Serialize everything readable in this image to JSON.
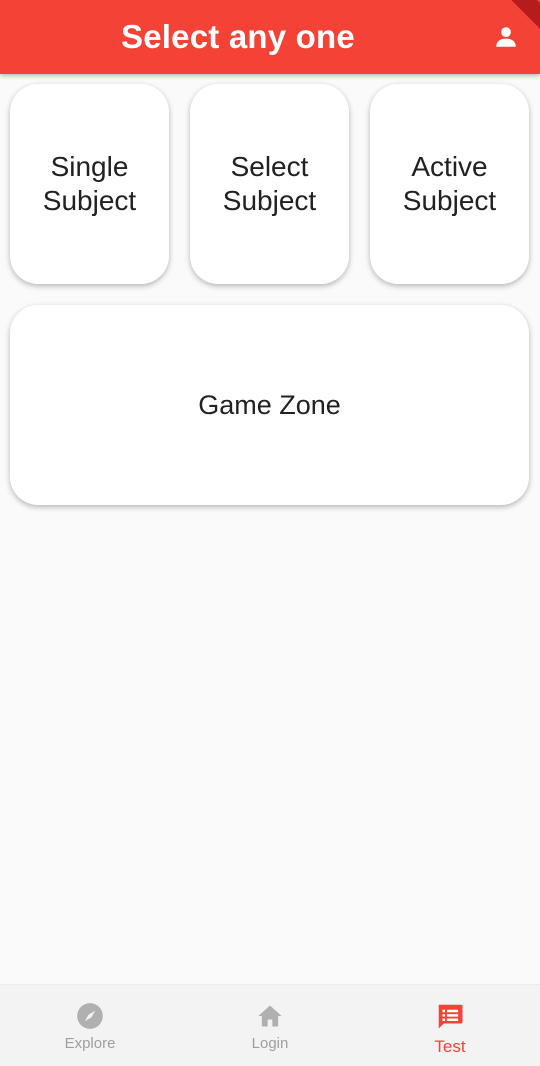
{
  "app_bar": {
    "title": "Select any one",
    "profile_icon": "person-icon",
    "color": "#f44336"
  },
  "cards": [
    {
      "line1": "Single",
      "line2": "Subject"
    },
    {
      "line1": "Select",
      "line2": "Subject"
    },
    {
      "line1": "Active",
      "line2": "Subject"
    }
  ],
  "game_zone": {
    "label": "Game Zone"
  },
  "bottom_nav": {
    "items": [
      {
        "label": "Explore",
        "icon": "compass-icon",
        "active": false
      },
      {
        "label": "Login",
        "icon": "home-icon",
        "active": false
      },
      {
        "label": "Test",
        "icon": "chat-list-icon",
        "active": true
      }
    ],
    "active_color": "#f44336",
    "inactive_color": "#9e9e9e"
  }
}
